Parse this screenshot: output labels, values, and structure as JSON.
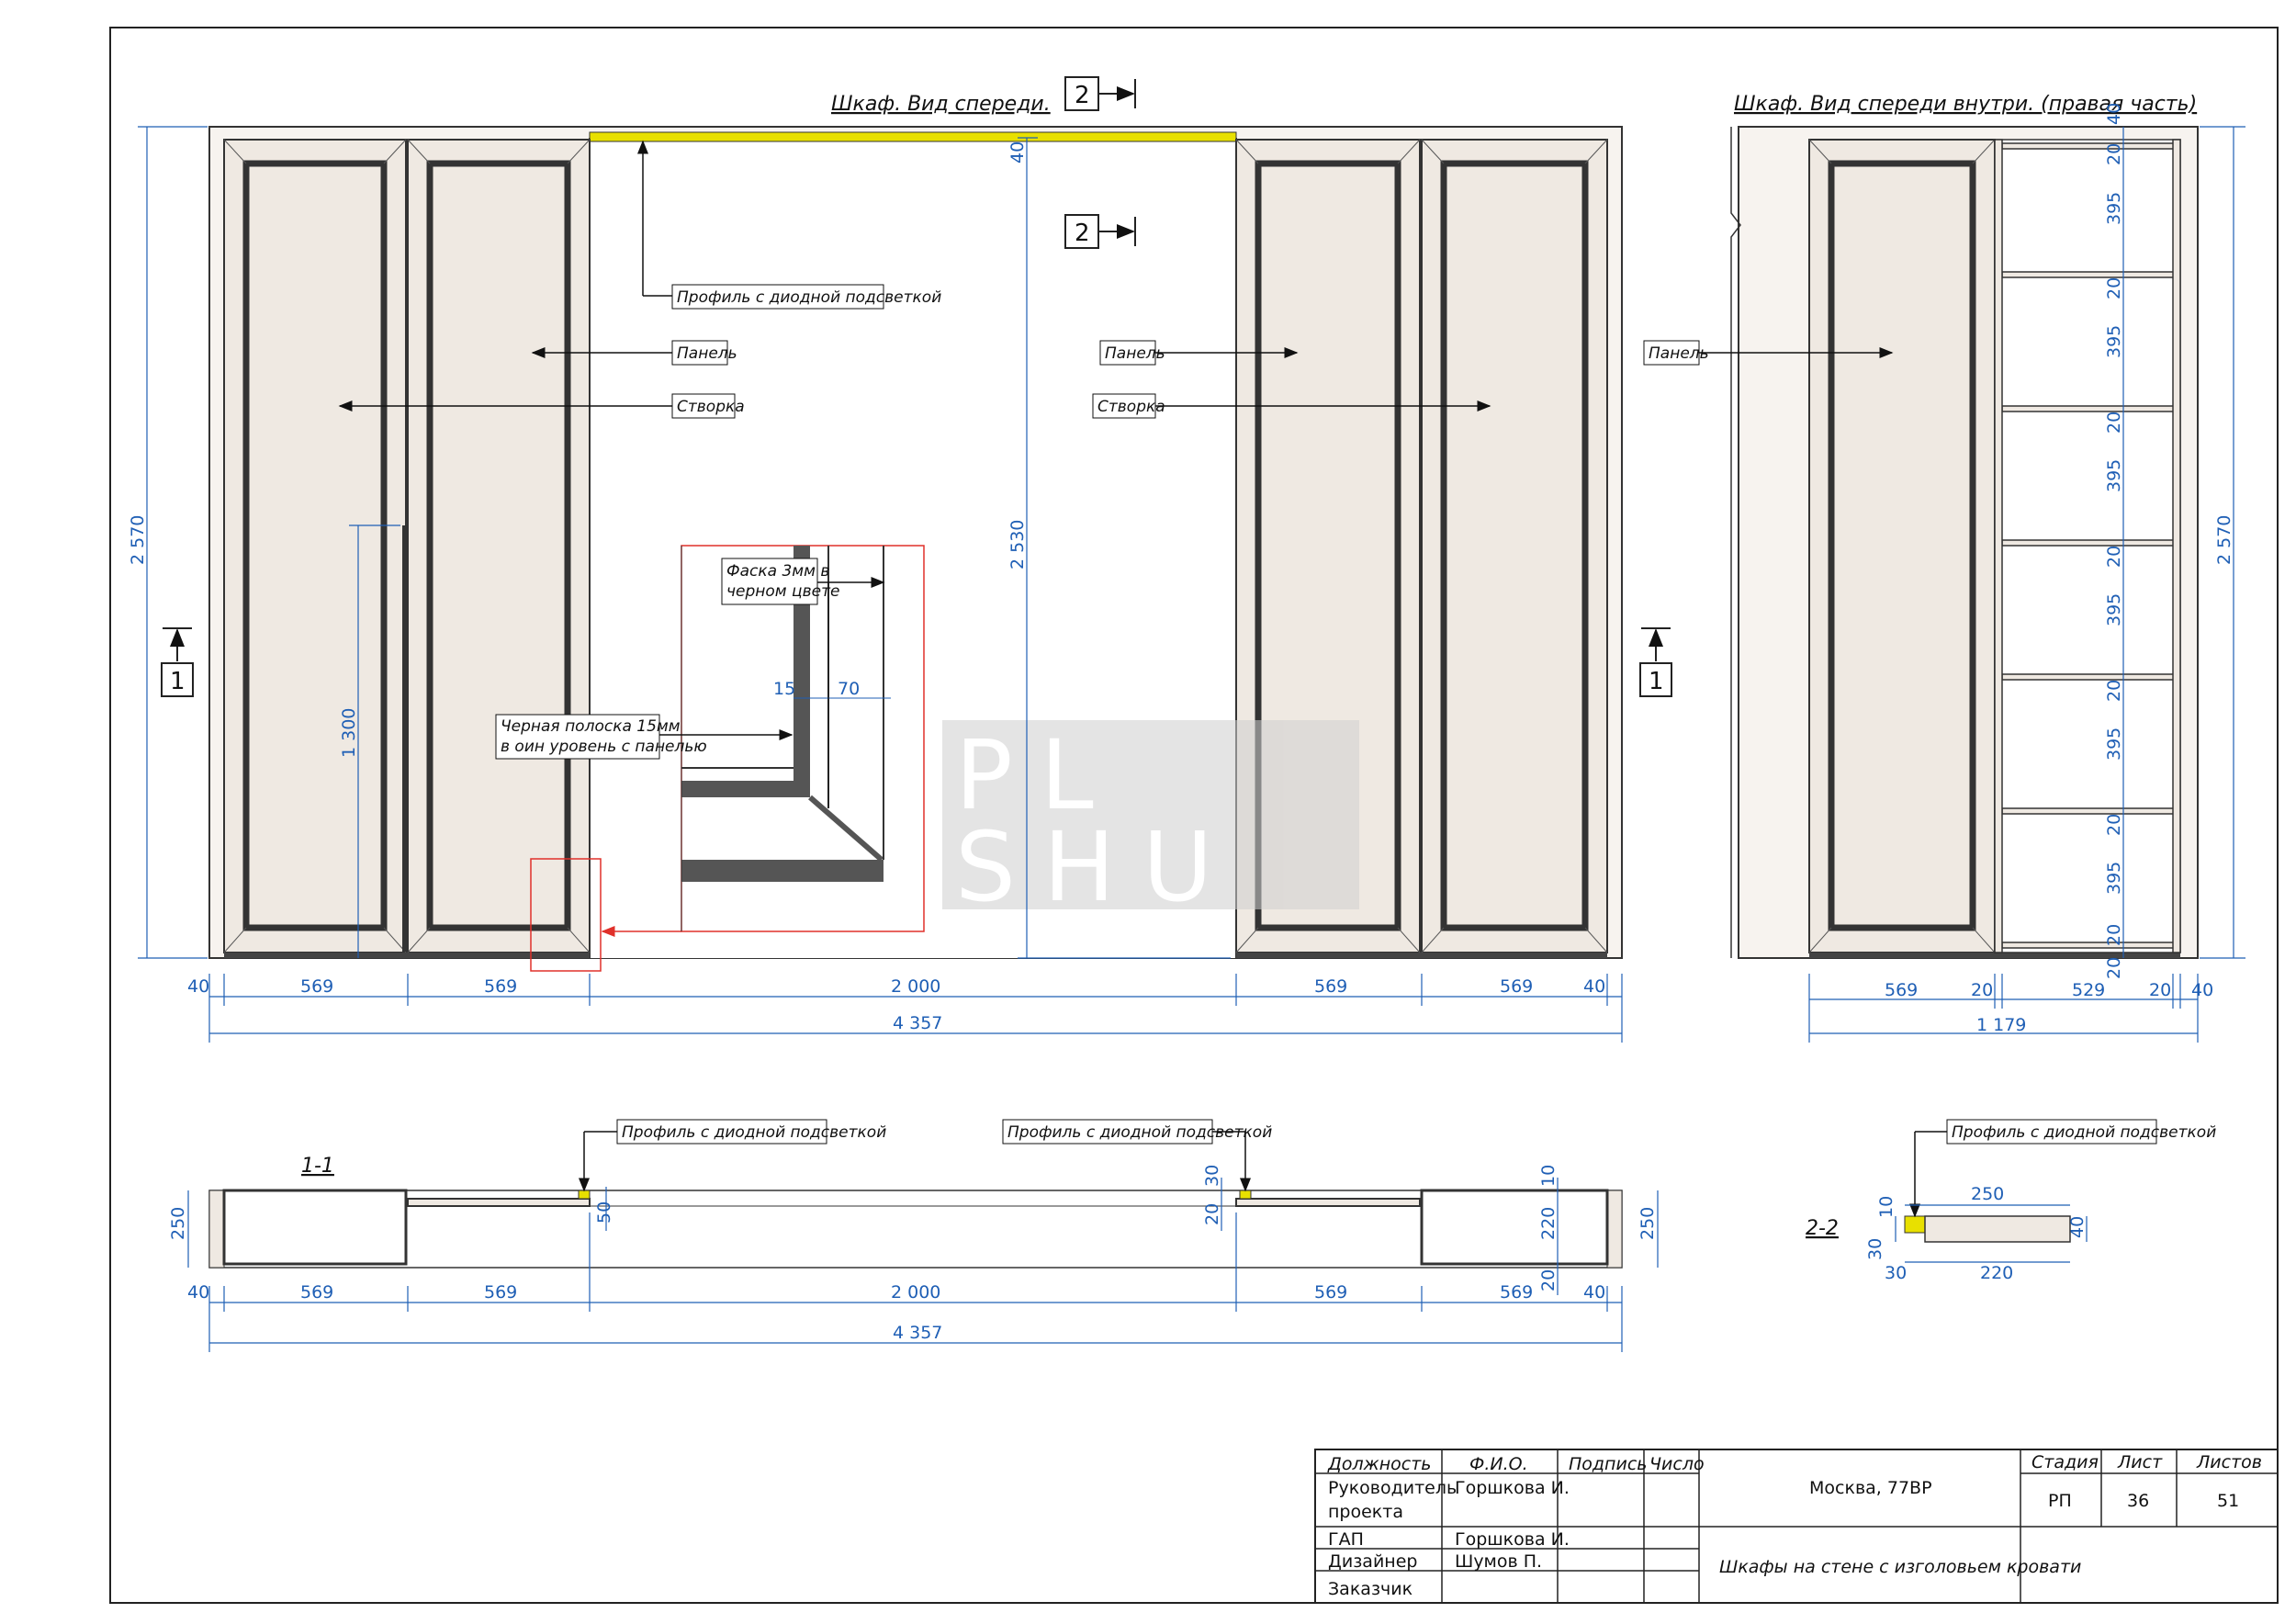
{
  "titles": {
    "front": "Шкаф. Вид спереди.",
    "front_inside": "Шкаф. Вид спереди внутри. (правая часть)",
    "section_1": "1-1",
    "section_2": "2-2"
  },
  "section_markers": {
    "one": "1",
    "two": "2"
  },
  "callouts": {
    "profile_led": "Профиль с диодной подсветкой",
    "panel": "Панель",
    "door": "Створка",
    "bevel_line1": "Фаска 3мм в",
    "bevel_line2": "черном цвете",
    "strip_line1": "Черная полоска 15мм",
    "strip_line2": "в оин уровень с панелью"
  },
  "dims": {
    "h2570": "2 570",
    "h2530": "2 530",
    "h1300": "1 300",
    "d40": "40",
    "d569": "569",
    "d2000": "2 000",
    "d4357": "4 357",
    "d15": "15",
    "d70": "70",
    "d20": "20",
    "d395": "395",
    "d529": "529",
    "d1179": "1 179",
    "d250": "250",
    "d50": "50",
    "d30": "30",
    "d10": "10",
    "d220": "220"
  },
  "watermark": {
    "line1": "PL",
    "line2": "SHU"
  },
  "title_block": {
    "headers": {
      "position": "Должность",
      "name": "Ф.И.О.",
      "signature": "Подпись",
      "date": "Число",
      "stage": "Стадия",
      "sheet": "Лист",
      "sheets": "Листов"
    },
    "rows": [
      {
        "position_l1": "Руководитель",
        "position_l2": "проекта",
        "name": "Горшкова И."
      },
      {
        "position_l1": "ГАП",
        "position_l2": "",
        "name": "Горшкова И."
      },
      {
        "position_l1": "Дизайнер",
        "position_l2": "",
        "name": "Шумов П."
      },
      {
        "position_l1": "Заказчик",
        "position_l2": "",
        "name": ""
      }
    ],
    "city": "Москва, 77ВР",
    "drawing_title": "Шкафы на стене с изголовьем кровати",
    "stage": "РП",
    "sheet": "36",
    "sheets": "51"
  },
  "colors": {
    "dimension": "#1f5fb5",
    "led": "#e8e000",
    "highlight": "#e0302a",
    "panel": "#efe9e2",
    "frame": "#333333"
  }
}
